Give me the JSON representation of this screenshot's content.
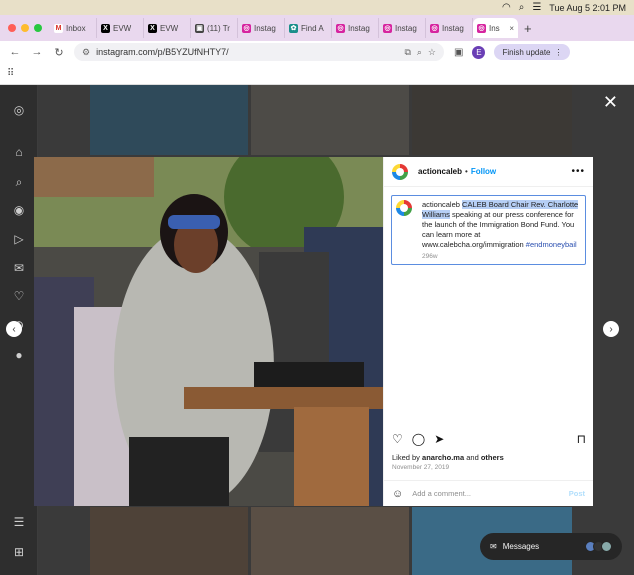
{
  "menubar": {
    "datetime": "Tue Aug 5  2:01 PM"
  },
  "tabs": [
    {
      "label": "Inbox",
      "fav_letter": "M",
      "fav_color": "#ffffff",
      "fav_text": "#d93025"
    },
    {
      "label": "EVW",
      "fav_letter": "X",
      "fav_color": "#000000",
      "fav_text": "#ffffff"
    },
    {
      "label": "EVW",
      "fav_letter": "X",
      "fav_color": "#000000",
      "fav_text": "#ffffff"
    },
    {
      "label": "(11) Tr",
      "fav_letter": "▣",
      "fav_color": "#444444",
      "fav_text": "#ffffff"
    },
    {
      "label": "Instag",
      "fav_letter": "◎",
      "fav_color": "#d6249f",
      "fav_text": "#ffffff"
    },
    {
      "label": "Find A",
      "fav_letter": "✿",
      "fav_color": "#1a8f8a",
      "fav_text": "#ffffff"
    },
    {
      "label": "Instag",
      "fav_letter": "◎",
      "fav_color": "#d6249f",
      "fav_text": "#ffffff"
    },
    {
      "label": "Instag",
      "fav_letter": "◎",
      "fav_color": "#d6249f",
      "fav_text": "#ffffff"
    },
    {
      "label": "Instag",
      "fav_letter": "◎",
      "fav_color": "#d6249f",
      "fav_text": "#ffffff"
    },
    {
      "label": "Instag",
      "fav_letter": "◎",
      "fav_color": "#d6249f",
      "fav_text": "#ffffff"
    }
  ],
  "active_tab": {
    "label": "Ins",
    "close": "×"
  },
  "address": {
    "url": "instagram.com/p/B5YZUfNHTY7/",
    "avatar_letter": "E",
    "finish_update": "Finish update"
  },
  "post": {
    "username": "actioncaleb",
    "follow_label": "Follow",
    "caption_user": "actioncaleb",
    "caption_highlight": "CALEB Board Chair Rev. Charlotte Williams",
    "caption_text": " speaking at our press conference for the launch of the Immigration Bond Fund. You can learn more at www.calebcha.org/immigration ",
    "caption_hashtag": "#endmoneybail",
    "caption_age": "296w",
    "liked_prefix": "Liked by ",
    "liked_user": "anarcho.ma",
    "liked_mid": " and ",
    "liked_others": "others",
    "date": "November 27, 2019",
    "comment_placeholder": "Add a comment...",
    "post_label": "Post"
  },
  "messages": {
    "label": "Messages"
  },
  "colors": {
    "instagram_blue": "#0095f6",
    "highlight": "#b6cff5",
    "tab_strip": "#e9d8ee"
  }
}
